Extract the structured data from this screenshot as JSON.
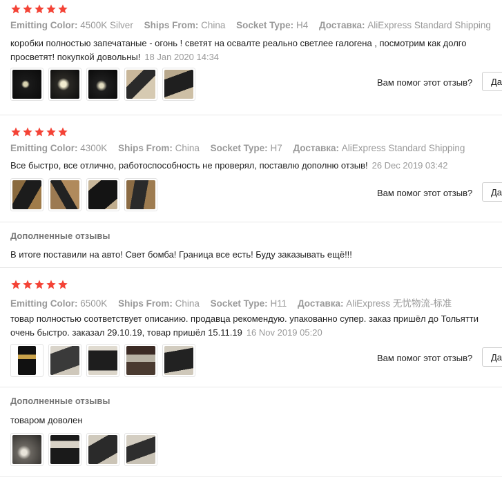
{
  "colors": {
    "star": "#f44336",
    "muted": "#999999",
    "text": "#222222"
  },
  "labels": {
    "emitting_color": "Emitting Color:",
    "ships_from": "Ships From:",
    "socket_type": "Socket Type:",
    "delivery": "Доставка:",
    "helpful_question": "Вам помог этот отзыв?",
    "yes": "Да",
    "additional_reviews": "Дополненные отзывы"
  },
  "reviews": [
    {
      "rating": 5,
      "emitting_color": "4500K Silver",
      "ships_from": "China",
      "socket_type": "H4",
      "delivery": "AliExpress Standard Shipping",
      "text_line1": "коробки полностью запечатаные - огонь ! светят на освалте реально светлее галогена , посмотрим как долго",
      "text_line2": "просветят! покупкой довольны!",
      "date": "18 Jan 2020 14:34",
      "photos": [
        "photo-night-road-1",
        "photo-night-road-2",
        "photo-night-road-3",
        "photo-bulb-box-1",
        "photo-bulb-box-2"
      ]
    },
    {
      "rating": 5,
      "emitting_color": "4300K",
      "ships_from": "China",
      "socket_type": "H7",
      "delivery": "AliExpress Standard Shipping",
      "text_line1": "Все быстро, все отлично, работоспособность не проверял, поставлю дополню отзыв!",
      "date": "26 Dec 2019 03:42",
      "photos": [
        "photo-package-1",
        "photo-package-2",
        "photo-package-3",
        "photo-package-4"
      ],
      "additional_text": "В итоге поставили на авто! Свет бомба! Граница все есть! Буду заказывать ещё!!!"
    },
    {
      "rating": 5,
      "emitting_color": "6500K",
      "ships_from": "China",
      "socket_type": "H11",
      "delivery": "AliExpress 无忧物流-标准",
      "text_line1": "товар полностью соответствует описанию. продавца рекомендую. упакованно супер. заказ пришёл до Тольятти",
      "text_line2": "очень быстро. заказал 29.10.19, товар пришёл 15.11.19",
      "date": "16 Nov 2019 05:20",
      "photos": [
        "photo-chip-1",
        "photo-car-1",
        "photo-bulbs-1",
        "photo-garage-1",
        "photo-bulbs-2"
      ],
      "additional_text": "товаром доволен",
      "additional_photos": [
        "photo-garage-2",
        "photo-bulbs-3",
        "photo-car-2",
        "photo-car-3"
      ]
    }
  ]
}
